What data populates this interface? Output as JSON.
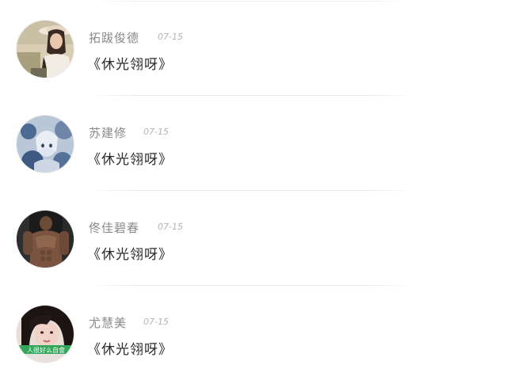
{
  "comments": [
    {
      "name": "拓跋俊德",
      "date": "07-15",
      "message": "《休光翎呀》",
      "avatar_icon": "avatar-woman-hat"
    },
    {
      "name": "苏建修",
      "date": "07-15",
      "message": "《休光翎呀》",
      "avatar_icon": "avatar-blue-illustration"
    },
    {
      "name": "佟佳碧春",
      "date": "07-15",
      "message": "《休光翎呀》",
      "avatar_icon": "avatar-muscle-man"
    },
    {
      "name": "尤慧美",
      "date": "07-15",
      "message": "《休光翎呀》",
      "avatar_icon": "avatar-girl-caption",
      "avatar_caption": "人很好么自會"
    }
  ]
}
